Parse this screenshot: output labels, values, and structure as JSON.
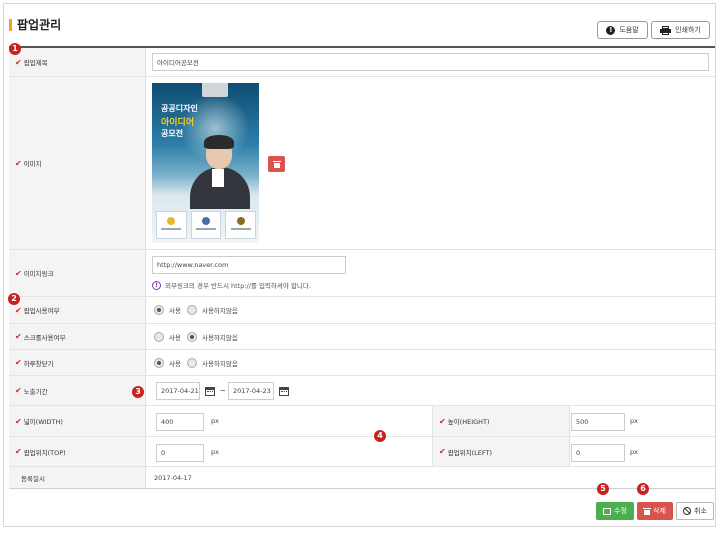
{
  "page": {
    "title": "팝업관리",
    "help_label": "도움말",
    "print_label": "인쇄하기"
  },
  "badges": [
    "1",
    "2",
    "3",
    "4",
    "5",
    "6"
  ],
  "form": {
    "title_label": "팝업제목",
    "title_value": "아이디어공모전",
    "image_label": "이미지",
    "image_alt": {
      "line1": "공공디자인",
      "line2": "아이디어",
      "line3": "공모전"
    },
    "link_label": "이미지링크",
    "link_value": "http://www.naver.com",
    "link_hint": "외부링크의 경우 반드시 http://를 입력하셔야 합니다.",
    "use_label": "팝업사용여부",
    "use_options": [
      "사용",
      "사용하지않음"
    ],
    "use_selected": "사용",
    "scroll_label": "스크롤사용여부",
    "scroll_options": [
      "사용",
      "사용하지않음"
    ],
    "scroll_selected": "사용하지않음",
    "today_label": "하루창닫기",
    "today_options": [
      "사용",
      "사용하지않음"
    ],
    "today_selected": "사용",
    "period_label": "노출기간",
    "period_start": "2017-04-21",
    "period_sep": "~",
    "period_end": "2017-04-23",
    "width_label": "넓이(WIDTH)",
    "width_value": "400",
    "height_label": "높이(HEIGHT)",
    "height_value": "500",
    "top_label": "팝업위치(TOP)",
    "top_value": "0",
    "left_label": "팝업위치(LEFT)",
    "left_value": "0",
    "unit": "px",
    "reg_label": "등록일시",
    "reg_value": "2017-04-17"
  },
  "actions": {
    "edit_label": "수정",
    "delete_label": "삭제",
    "cancel_label": "취소"
  },
  "colors": {
    "accent_bar": "#f2a21f",
    "check": "#c4302b",
    "badge": "#c8221f",
    "edit_button": "#4bae4f",
    "delete_button": "#d9534f"
  }
}
